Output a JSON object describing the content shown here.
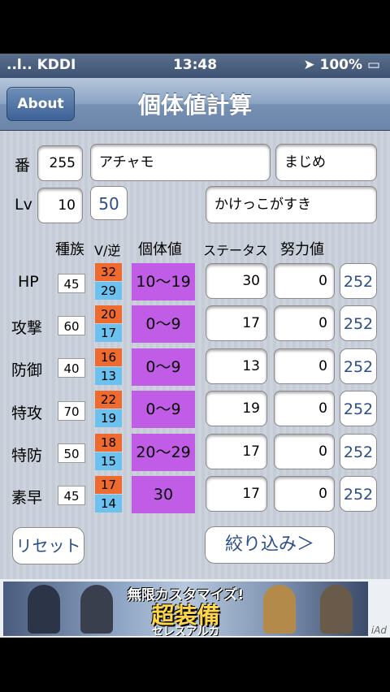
{
  "status_bar": {
    "carrier": "..l.. KDDI",
    "time": "13:48",
    "battery": "100%"
  },
  "nav": {
    "about_label": "About",
    "title": "個体値計算"
  },
  "form": {
    "number_label": "番",
    "number_value": "255",
    "name_value": "アチャモ",
    "nature_value": "まじめ",
    "level_label": "Lv",
    "level_value": "10",
    "level_button": "50",
    "characteristic_value": "かけっこがすき"
  },
  "headers": {
    "base": "種族",
    "v": "V/逆",
    "iv": "個体値",
    "status": "ステータス",
    "ev": "努力値"
  },
  "rows": [
    {
      "name": "HP",
      "base": "45",
      "v_top": "32",
      "v_bottom": "29",
      "iv": "10〜19",
      "status": "30",
      "ev": "0",
      "ev_button": "252"
    },
    {
      "name": "攻撃",
      "base": "60",
      "v_top": "20",
      "v_bottom": "17",
      "iv": "0〜9",
      "status": "17",
      "ev": "0",
      "ev_button": "252"
    },
    {
      "name": "防御",
      "base": "40",
      "v_top": "16",
      "v_bottom": "13",
      "iv": "0〜9",
      "status": "13",
      "ev": "0",
      "ev_button": "252"
    },
    {
      "name": "特攻",
      "base": "70",
      "v_top": "22",
      "v_bottom": "19",
      "iv": "0〜9",
      "status": "19",
      "ev": "0",
      "ev_button": "252"
    },
    {
      "name": "特防",
      "base": "50",
      "v_top": "18",
      "v_bottom": "15",
      "iv": "20〜29",
      "status": "17",
      "ev": "0",
      "ev_button": "252"
    },
    {
      "name": "素早",
      "base": "45",
      "v_top": "17",
      "v_bottom": "14",
      "iv": "30",
      "status": "17",
      "ev": "0",
      "ev_button": "252"
    }
  ],
  "buttons": {
    "reset": "リセット",
    "filter": "絞り込み＞"
  },
  "ad": {
    "line1": "無限カスタマイズ!",
    "line2": "超装備",
    "line3": "セレスアルカ",
    "iad": "iAd"
  },
  "colors": {
    "v_top": "#ef6a2f",
    "v_bottom": "#6cc1ef",
    "iv": "#c15ce6",
    "accent": "#2b4e8c"
  }
}
